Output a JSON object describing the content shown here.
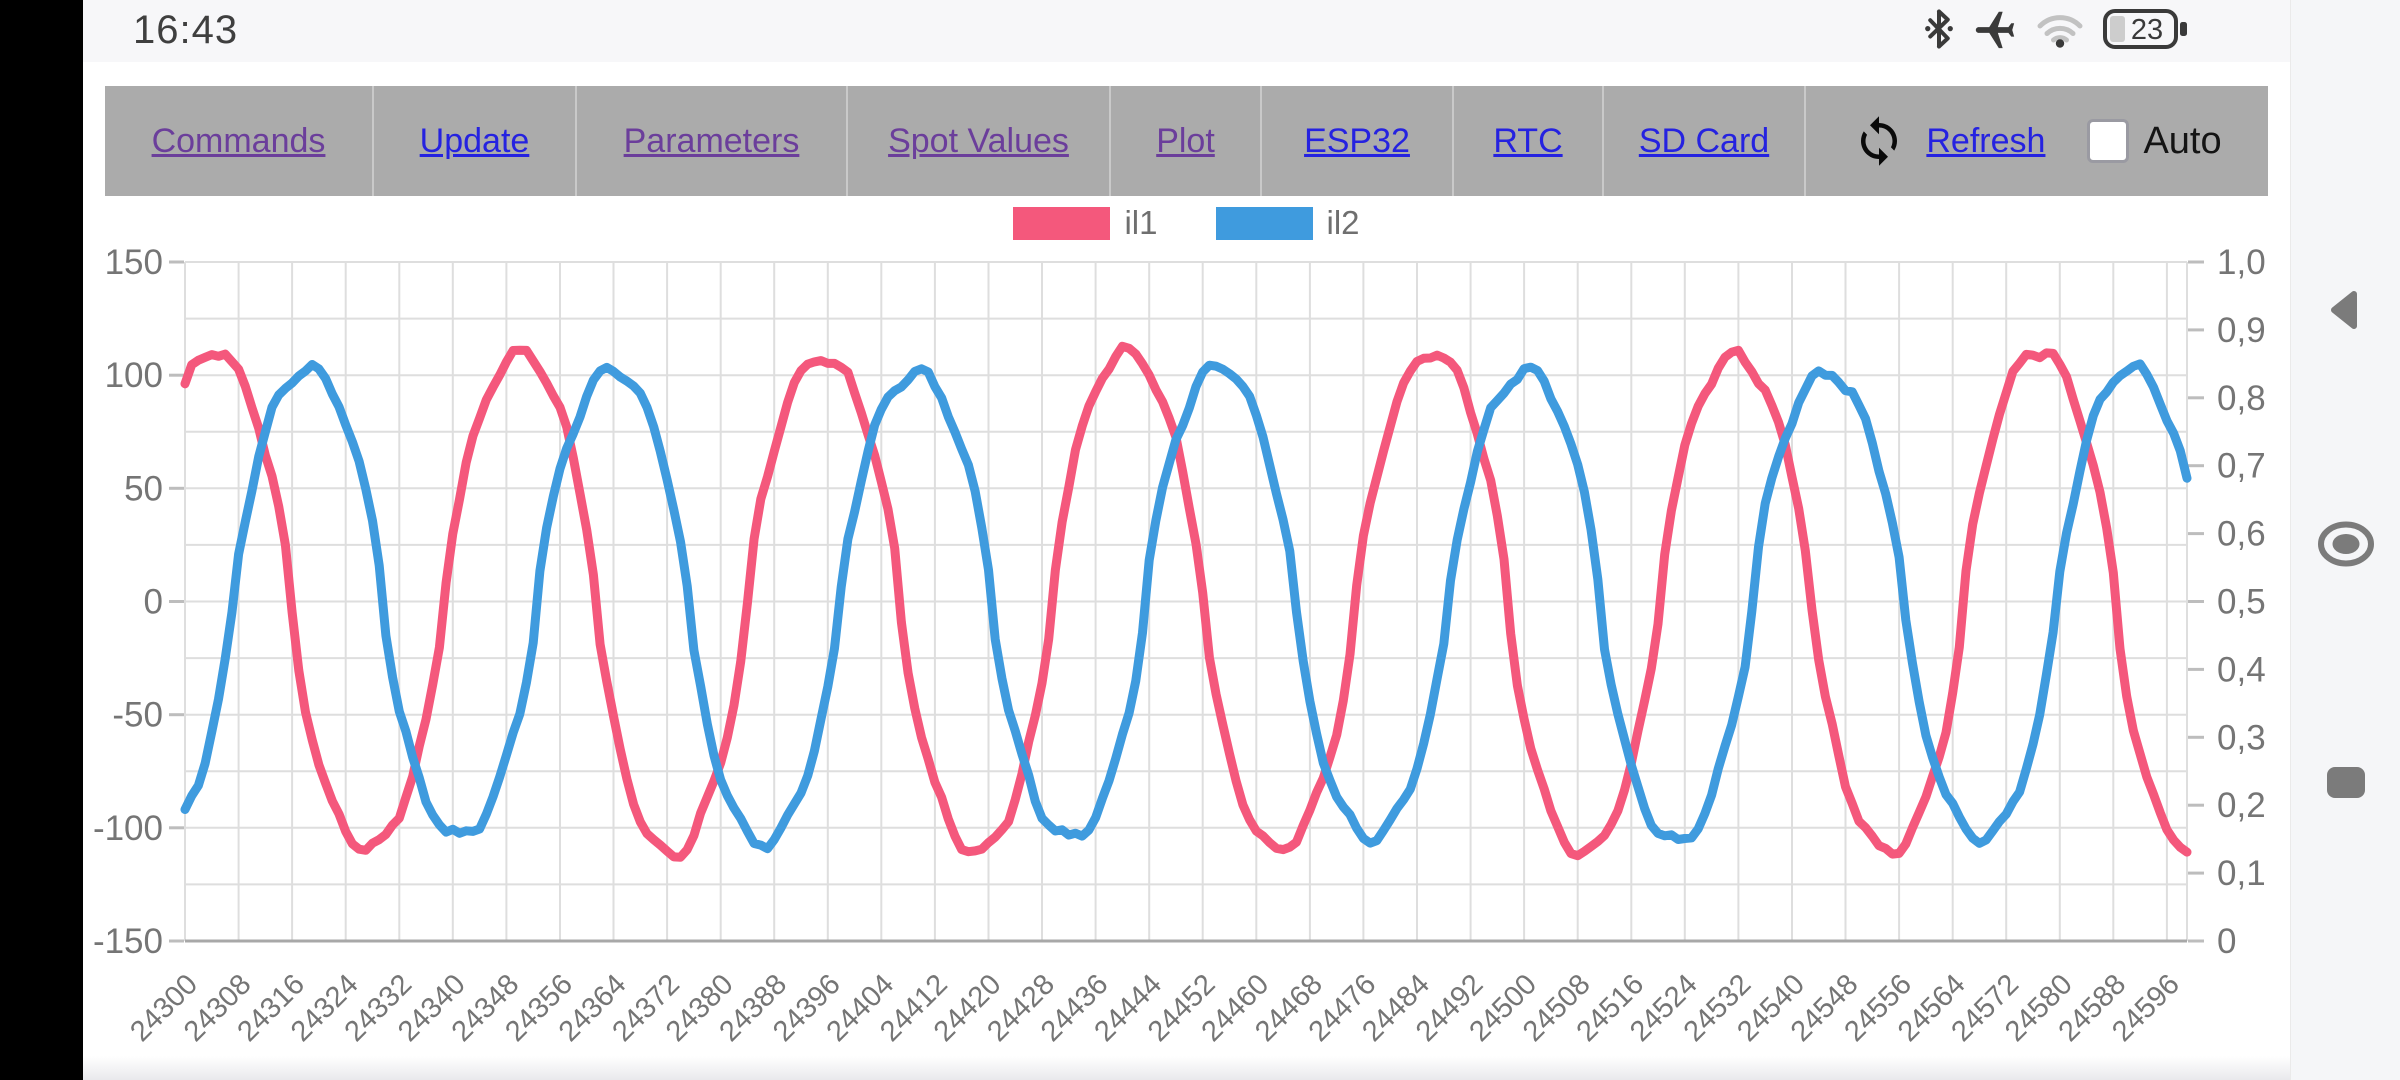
{
  "status_bar": {
    "time": "16:43",
    "battery_percent": "23",
    "icons": [
      "bluetooth-icon",
      "airplane-mode-icon",
      "wifi-icon",
      "battery-icon"
    ]
  },
  "toolbar": {
    "links": [
      {
        "label": "Commands",
        "style": "visited"
      },
      {
        "label": "Update",
        "style": "link"
      },
      {
        "label": "Parameters",
        "style": "visited"
      },
      {
        "label": "Spot Values",
        "style": "visited"
      },
      {
        "label": "Plot",
        "style": "visited"
      },
      {
        "label": "ESP32",
        "style": "link"
      },
      {
        "label": "RTC",
        "style": "link"
      },
      {
        "label": "SD Card",
        "style": "link"
      }
    ],
    "refresh_label": "Refresh",
    "auto_label": "Auto",
    "auto_checked": false,
    "colors": {
      "visited": "#6b3e9b",
      "link": "#2522e0",
      "bar_background": "#ababab"
    }
  },
  "android_nav": {
    "buttons": [
      "back",
      "home",
      "recents"
    ]
  },
  "chart_data": {
    "type": "line",
    "title": "",
    "x_min": 24300,
    "x_max": 24599,
    "x_tick_step": 8,
    "x_ticks": [
      "24300",
      "24308",
      "24316",
      "24324",
      "24332",
      "24340",
      "24348",
      "24356",
      "24364",
      "24372",
      "24380",
      "24388",
      "24396",
      "24404",
      "24412",
      "24420",
      "24428",
      "24436",
      "24444",
      "24452",
      "24460",
      "24468",
      "24476",
      "24484",
      "24492",
      "24500",
      "24508",
      "24516",
      "24524",
      "24532",
      "24540",
      "24548",
      "24556",
      "24564",
      "24572",
      "24580",
      "24588",
      "24596"
    ],
    "y_left_min": -150,
    "y_left_max": 150,
    "y_left_ticks": [
      150,
      100,
      50,
      0,
      -50,
      -100,
      -150
    ],
    "y_grid_step": 25,
    "y_right_ticks": [
      "1,0",
      "0,9",
      "0,8",
      "0,7",
      "0,6",
      "0,5",
      "0,4",
      "0,3",
      "0,2",
      "0,1",
      "0"
    ],
    "grid": true,
    "legend_position": "top-center",
    "colors": {
      "grid": "#dedede",
      "axis": "#a8a8a8",
      "tick_text": "#757575"
    },
    "series": [
      {
        "name": "il1",
        "color": "#f4587c",
        "waveform": "flat-top distorted sine (measured phase current)",
        "approx_amplitude": 110,
        "approx_period_samples": 45.4,
        "approx_peak_positions": [
          24305,
          24350,
          24395,
          24441,
          24486,
          24531,
          24577
        ],
        "approx_trough_value": -110,
        "start_value": 93,
        "gen": {
          "period": 45.4,
          "peak_x": 24304.6,
          "amplitude": 110,
          "offset": -0.5,
          "shape": 0.72,
          "wobble": 2.3,
          "wphase": 0.7,
          "jitter": 1.2
        }
      },
      {
        "name": "il2",
        "color": "#3f9bde",
        "waveform": "flat-top distorted sine (measured phase current)",
        "approx_amplitude": 103,
        "approx_period_samples": 45.4,
        "approx_peak_positions": [
          24318,
          24364,
          24409,
          24455,
          24500,
          24545,
          24591
        ],
        "approx_trough_value": -106,
        "start_value": -97,
        "gen": {
          "period": 45.4,
          "peak_x": 24318.4,
          "amplitude": 103.5,
          "offset": -1.5,
          "shape": 0.72,
          "wobble": 2.3,
          "wphase": 2.4,
          "jitter": 1.2
        }
      }
    ]
  }
}
